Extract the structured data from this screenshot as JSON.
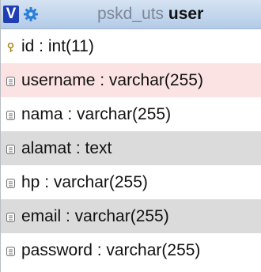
{
  "header": {
    "toggle_label": "V",
    "settings_icon": "gear-icon",
    "database": "pskd_uts",
    "table": "user",
    "colors": {
      "toggle_bg": "#1f3fb3",
      "header_bg": "#c4d6ed"
    }
  },
  "columns": [
    {
      "label": "id : int(11)",
      "icon": "key-icon",
      "style": "plain"
    },
    {
      "label": "username : varchar(255)",
      "icon": "column-icon",
      "style": "highlight"
    },
    {
      "label": "nama : varchar(255)",
      "icon": "column-icon",
      "style": "plain"
    },
    {
      "label": "alamat : text",
      "icon": "column-icon",
      "style": "alt"
    },
    {
      "label": "hp : varchar(255)",
      "icon": "column-icon",
      "style": "plain"
    },
    {
      "label": "email : varchar(255)",
      "icon": "column-icon",
      "style": "alt"
    },
    {
      "label": "password : varchar(255)",
      "icon": "column-icon",
      "style": "plain"
    }
  ]
}
